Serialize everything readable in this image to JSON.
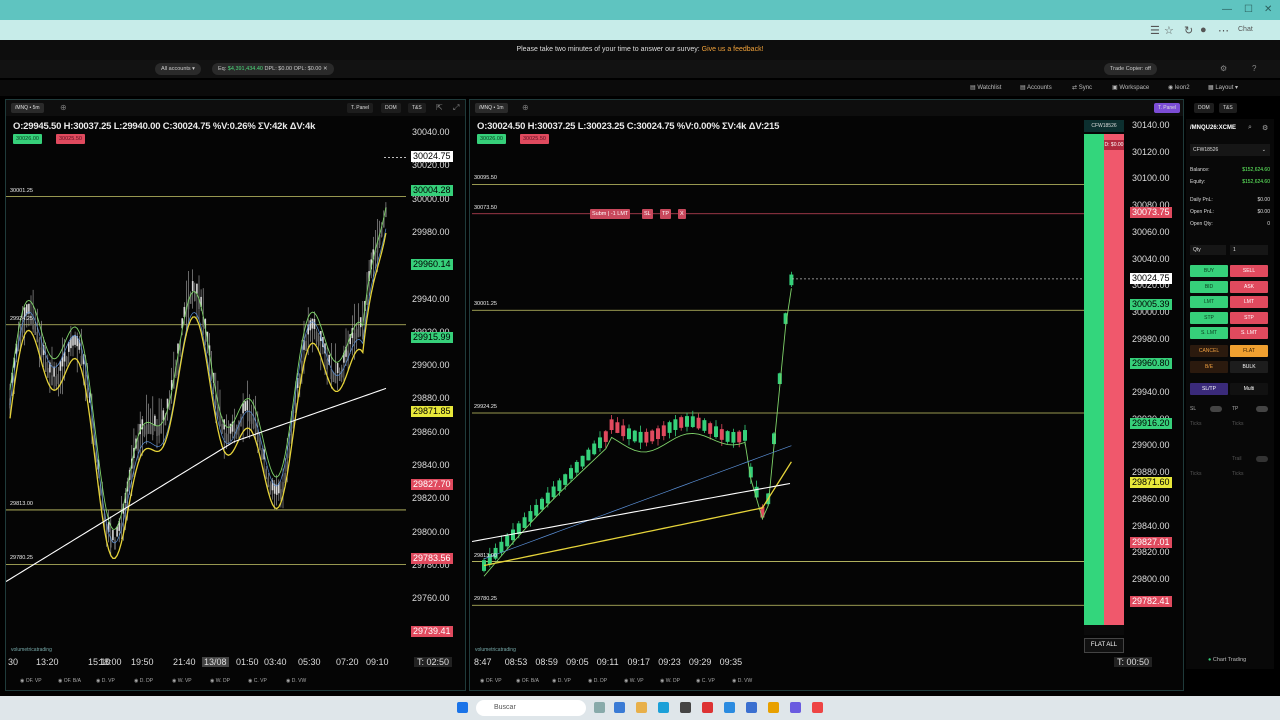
{
  "browser": {
    "chat": "Chat"
  },
  "survey": {
    "text": "Please take two minutes of your time to answer our survey:",
    "link": "Give us a feedback!"
  },
  "toolbar": {
    "accounts": "All accounts",
    "eq_label": "Eq:",
    "eq_value": "$4,391,434.40",
    "dpl": "DPL: $0.00",
    "opl": "OPL: $0.00",
    "trade_copier": "Trade Copier: off"
  },
  "menu": {
    "watchlist": "Watchlist",
    "accounts": "Accounts",
    "sync": "Sync",
    "workspace": "Workspace",
    "user": "leon2",
    "layout": "Layout"
  },
  "left_chart": {
    "symbol": "/MNQ • 5m",
    "btn_tpanel": "T. Panel",
    "btn_dom": "DOM",
    "btn_ts": "T&S",
    "ohlc": "O:29945.50  H:30037.25  L:29940.00  C:30024.75  %V:0.26%  ΣV:42k  ΔV:4k",
    "bid_badge": "30026.00",
    "ask_badge": "30025.50",
    "axis": [
      "30040.00",
      "30020.00",
      "30000.00",
      "29980.00",
      "29960.00",
      "29940.00",
      "29920.00",
      "29900.00",
      "29880.00",
      "29860.00",
      "29840.00",
      "29820.00",
      "29800.00",
      "29780.00",
      "29760.00"
    ],
    "levels": [
      "30001.25",
      "29924.25",
      "29813.00",
      "29780.25"
    ],
    "tags": [
      {
        "v": "30024.75",
        "c": "#ffffff",
        "t": "#000"
      },
      {
        "v": "30004.28",
        "c": "#36d07a",
        "t": "#000"
      },
      {
        "v": "29960.14",
        "c": "#36d07a",
        "t": "#000"
      },
      {
        "v": "29915.99",
        "c": "#36d07a",
        "t": "#000"
      },
      {
        "v": "29871.85",
        "c": "#e8e83a",
        "t": "#000"
      },
      {
        "v": "29827.70",
        "c": "#e04a5e",
        "t": "#fff"
      },
      {
        "v": "29783.56",
        "c": "#e04a5e",
        "t": "#fff"
      },
      {
        "v": "29739.41",
        "c": "#e04a5e",
        "t": "#fff"
      }
    ],
    "times": [
      "30",
      "13:20",
      "15:10",
      "18:00",
      "19:50",
      "21:40",
      "13/08",
      "01:50",
      "03:40",
      "05:30",
      "07:20",
      "09:10"
    ],
    "countdown": "T: 02:50",
    "logo": "volumetricatrading",
    "studies": [
      "OF. VP",
      "OF. B/A",
      "D. VP",
      "D. DP",
      "W. VP",
      "W. DP",
      "C. VP",
      "D. VW"
    ]
  },
  "right_chart": {
    "symbol": "/MNQ • 1m",
    "btn_tpanel": "T. Panel",
    "btn_dom": "DOM",
    "btn_ts": "T&S",
    "ohlc": "O:30024.50  H:30037.25  L:30023.25  C:30024.75  %V:0.00%  ΣV:4k  ΔV:215",
    "bid_badge": "30026.00",
    "ask_badge": "30025.50",
    "axis": [
      "30140.00",
      "30120.00",
      "30100.00",
      "30080.00",
      "30060.00",
      "30040.00",
      "30020.00",
      "30000.00",
      "29980.00",
      "29960.00",
      "29940.00",
      "29920.00",
      "29900.00",
      "29880.00",
      "29860.00",
      "29840.00",
      "29820.00",
      "29800.00"
    ],
    "levels": [
      "30095.50",
      "30073.50",
      "30001.25",
      "29924.25",
      "29813.00",
      "29780.25"
    ],
    "order_tags": [
      "Subm | -1 LMT",
      "SL",
      "TP",
      "X"
    ],
    "tags": [
      {
        "v": "30073.75",
        "c": "#e04a5e",
        "t": "#fff"
      },
      {
        "v": "30024.75",
        "c": "#ffffff",
        "t": "#000"
      },
      {
        "v": "30005.39",
        "c": "#36d07a",
        "t": "#000"
      },
      {
        "v": "29960.80",
        "c": "#36d07a",
        "t": "#000"
      },
      {
        "v": "29916.20",
        "c": "#36d07a",
        "t": "#000"
      },
      {
        "v": "29871.60",
        "c": "#e8e83a",
        "t": "#000"
      },
      {
        "v": "29827.01",
        "c": "#e04a5e",
        "t": "#fff"
      },
      {
        "v": "29782.41",
        "c": "#e04a5e",
        "t": "#fff"
      }
    ],
    "times": [
      "8:47",
      "08:53",
      "08:59",
      "09:05",
      "09:11",
      "09:17",
      "09:23",
      "09:29",
      "09:35"
    ],
    "countdown": "T: 00:50",
    "logo": "volumetricatrading",
    "dom_account": "CFW18526",
    "dom_pnl": "D: $0.00",
    "flat_all": "FLAT ALL",
    "studies": [
      "OF. VP",
      "OF. B/A",
      "D. VP",
      "D. DP",
      "W. VP",
      "W. DP",
      "C. VP",
      "D. VW"
    ]
  },
  "side": {
    "symbol": "/MNQU26:XCME",
    "account": "CFW18526",
    "rows": [
      {
        "k": "Balance:",
        "v": "$152,624.60"
      },
      {
        "k": "Equity:",
        "v": "$152,624.60"
      },
      {
        "k": "Daily PnL:",
        "v": "$0.00"
      },
      {
        "k": "Open PnL:",
        "v": "$0.00"
      },
      {
        "k": "Open Qty:",
        "v": "0"
      }
    ],
    "qty_label": "Qty",
    "qty_value": "1",
    "buttons": [
      [
        "BUY",
        "SELL"
      ],
      [
        "BID",
        "ASK"
      ],
      [
        "LMT",
        "LMT"
      ],
      [
        "STP",
        "STP"
      ],
      [
        "S. LMT",
        "S. LMT"
      ]
    ],
    "cancel": "CANCEL",
    "flat": "FLAT",
    "be": "B/E",
    "bulk": "BULK",
    "sltp": "SL/TP",
    "multi": "Multi",
    "sl": "SL",
    "tp": "TP",
    "ticks": "Ticks",
    "trail": "Trail",
    "footer": "Chart Trading"
  },
  "taskbar": {
    "search": "Buscar"
  }
}
